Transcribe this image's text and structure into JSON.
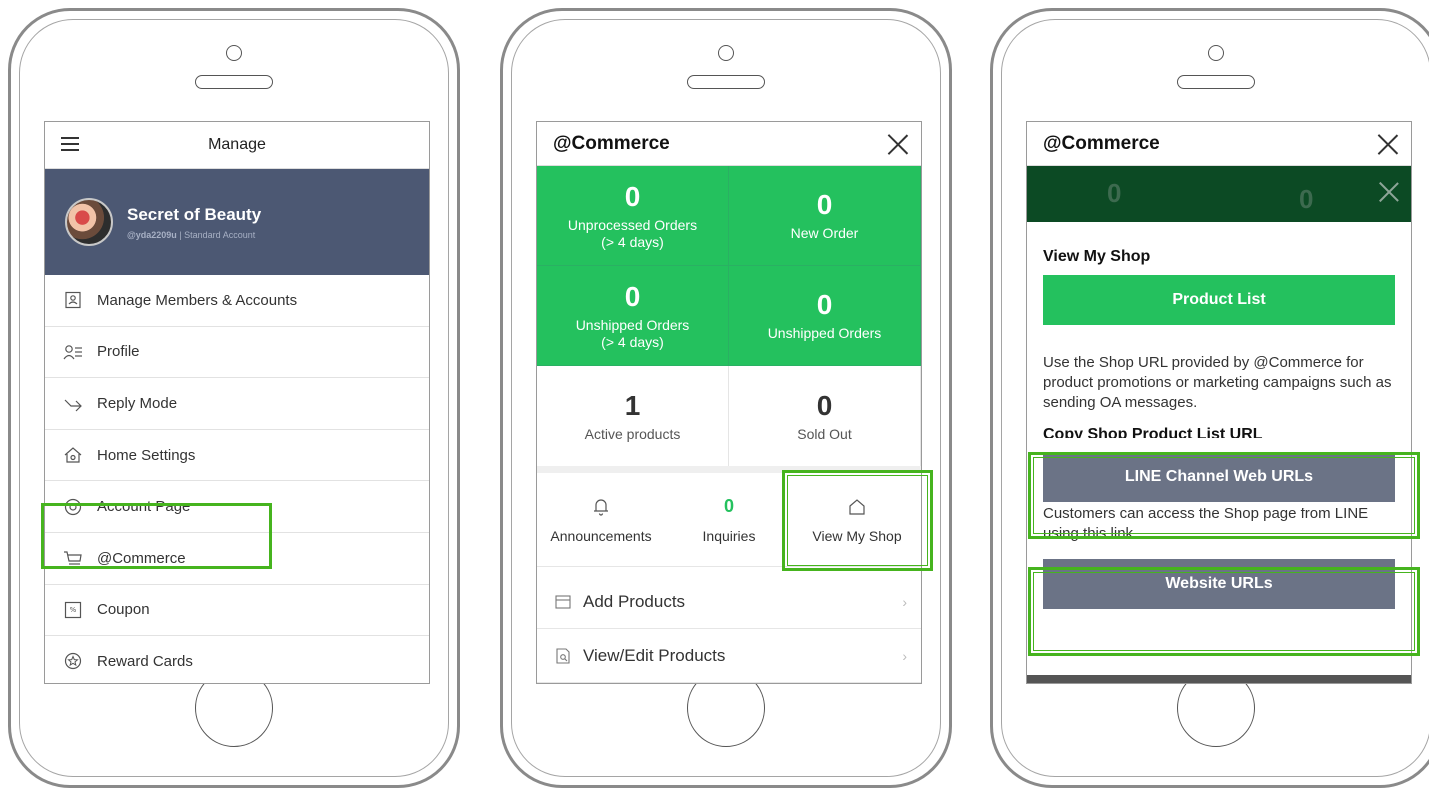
{
  "phone1": {
    "header_title": "Manage",
    "profile": {
      "name": "Secret of Beauty",
      "id": "@yda2209u",
      "account_type": "Standard Account"
    },
    "menu": [
      {
        "label": "Manage Members & Accounts",
        "icon": "contact-icon"
      },
      {
        "label": "Profile",
        "icon": "profile-icon"
      },
      {
        "label": "Reply Mode",
        "icon": "reply-icon"
      },
      {
        "label": "Home Settings",
        "icon": "home-settings-icon"
      },
      {
        "label": "Account Page",
        "icon": "at-icon"
      },
      {
        "label": "@Commerce",
        "icon": "cart-icon"
      },
      {
        "label": "Coupon",
        "icon": "coupon-icon"
      },
      {
        "label": "Reward Cards",
        "icon": "star-icon"
      }
    ]
  },
  "phone2": {
    "header_title": "@Commerce",
    "stats": [
      {
        "value": "0",
        "label": "Unprocessed Orders\n(> 4 days)"
      },
      {
        "value": "0",
        "label": "New Order"
      },
      {
        "value": "0",
        "label": "Unshipped Orders\n(> 4 days)"
      },
      {
        "value": "0",
        "label": "Unshipped Orders"
      },
      {
        "value": "1",
        "label": "Active products"
      },
      {
        "value": "0",
        "label": "Sold Out"
      }
    ],
    "quick": {
      "announcements": "Announcements",
      "inquiries_count": "0",
      "inquiries": "Inquiries",
      "view_shop": "View My Shop"
    },
    "rows": [
      {
        "label": "Add Products",
        "chevron": "›"
      },
      {
        "label": "View/Edit Products",
        "chevron": "›"
      }
    ]
  },
  "phone3": {
    "header_title": "@Commerce",
    "bg_values": [
      "0",
      "0"
    ],
    "section_title": "View My Shop",
    "product_list_button": "Product List",
    "description": "Use the Shop URL provided by @Commerce for product promotions or marketing campaigns such as sending OA messages.",
    "copy_heading": "Copy Shop Product List URL",
    "line_button": "LINE Channel Web URLs",
    "line_note": "Customers can access the Shop page from LINE using this link.",
    "website_button": "Website URLs"
  },
  "colors": {
    "green": "#24c15e",
    "dark_green": "#0c4a24",
    "slate_button": "#6b7386",
    "profile_bg": "#4c5873",
    "highlight": "#46b41e"
  }
}
